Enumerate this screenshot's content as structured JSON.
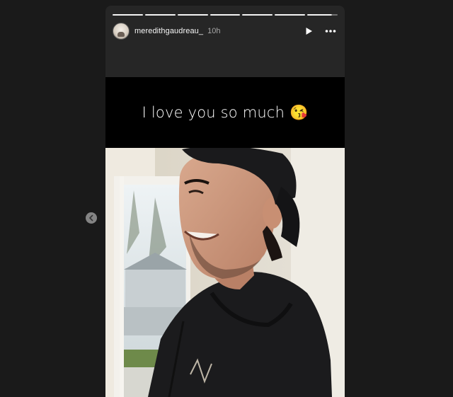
{
  "story": {
    "username": "meredithgaudreau_",
    "time_ago": "10h",
    "caption_text": "I love you so much",
    "caption_emoji": "😘",
    "progress_segments": 7,
    "current_segment_progress": 0.8
  },
  "icons": {
    "avatar": "avatar-icon",
    "play": "play-icon",
    "more": "more-options-icon",
    "previous": "chevron-left-icon"
  },
  "colors": {
    "background": "#1a1a1a",
    "story_bg": "#262626",
    "caption_band": "#000000",
    "text_primary": "#f5f5f5",
    "text_secondary": "#a8a8a8"
  }
}
